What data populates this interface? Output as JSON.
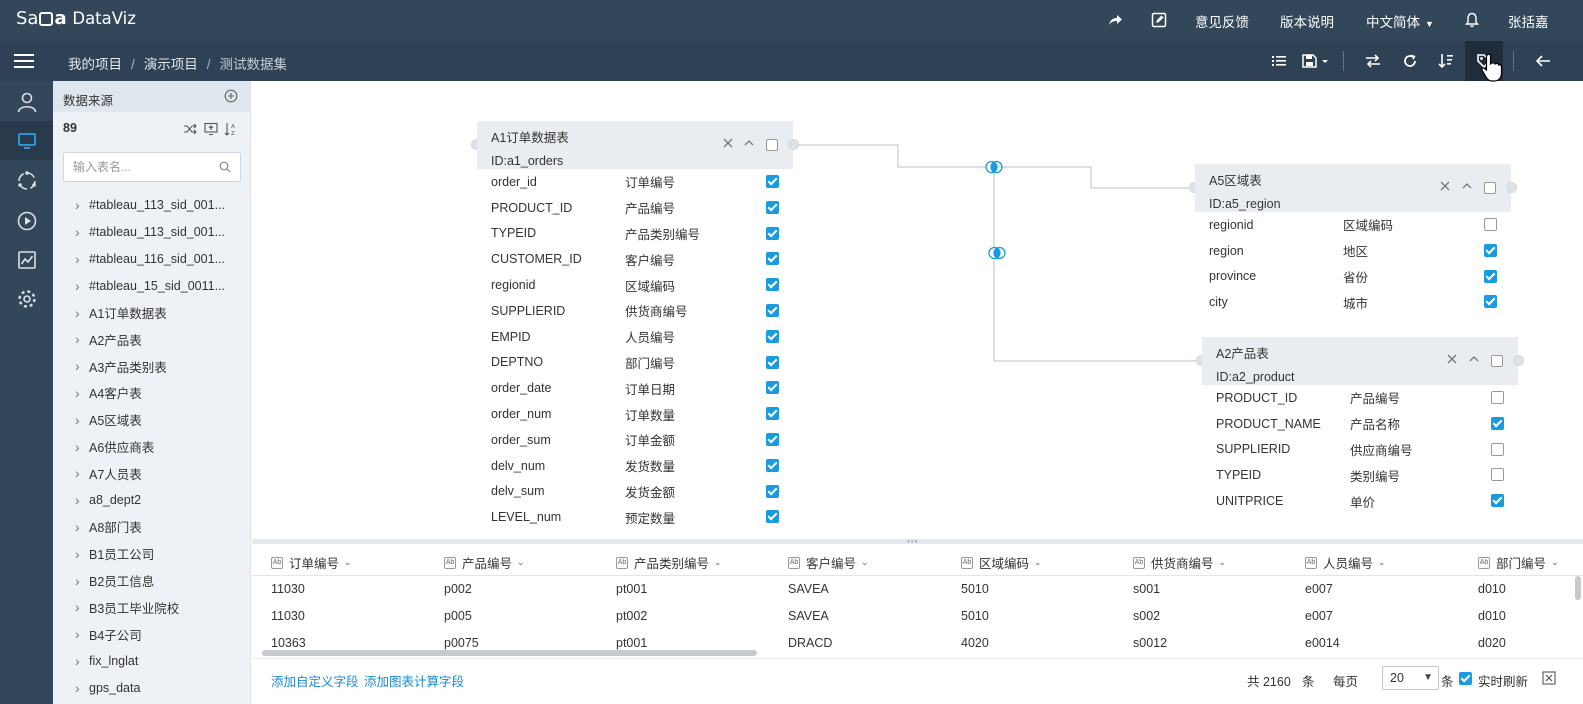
{
  "header": {
    "logo_text": "Sa",
    "logo_rest": "DataViz",
    "feedback": "意见反馈",
    "release_notes": "版本说明",
    "language": "中文简体",
    "user": "张括嘉"
  },
  "breadcrumb": [
    "我的项目",
    "演示项目",
    "测试数据集"
  ],
  "sidebar": {
    "title": "数据来源",
    "count": "89",
    "search_placeholder": "输入表名...",
    "items": [
      "#tableau_113_sid_001...",
      "#tableau_113_sid_001...",
      "#tableau_116_sid_001...",
      "#tableau_15_sid_0011...",
      "A1订单数据表",
      "A2产品表",
      "A3产品类别表",
      "A4客户表",
      "A5区域表",
      "A6供应商表",
      "A7人员表",
      "a8_dept2",
      "A8部门表",
      "B1员工公司",
      "B2员工信息",
      "B3员工毕业院校",
      "B4子公司",
      "fix_lnglat",
      "gps_data"
    ]
  },
  "tables": {
    "orders": {
      "title": "A1订单数据表",
      "id": "ID:a1_orders",
      "fields": [
        {
          "name": "order_id",
          "label": "订单编号",
          "checked": true
        },
        {
          "name": "PRODUCT_ID",
          "label": "产品编号",
          "checked": true
        },
        {
          "name": "TYPEID",
          "label": "产品类别编号",
          "checked": true
        },
        {
          "name": "CUSTOMER_ID",
          "label": "客户编号",
          "checked": true
        },
        {
          "name": "regionid",
          "label": "区域编码",
          "checked": true
        },
        {
          "name": "SUPPLIERID",
          "label": "供货商编号",
          "checked": true
        },
        {
          "name": "EMPID",
          "label": "人员编号",
          "checked": true
        },
        {
          "name": "DEPTNO",
          "label": "部门编号",
          "checked": true
        },
        {
          "name": "order_date",
          "label": "订单日期",
          "checked": true
        },
        {
          "name": "order_num",
          "label": "订单数量",
          "checked": true
        },
        {
          "name": "order_sum",
          "label": "订单金额",
          "checked": true
        },
        {
          "name": "delv_num",
          "label": "发货数量",
          "checked": true
        },
        {
          "name": "delv_sum",
          "label": "发货金额",
          "checked": true
        },
        {
          "name": "LEVEL_num",
          "label": "预定数量",
          "checked": true
        }
      ]
    },
    "region": {
      "title": "A5区域表",
      "id": "ID:a5_region",
      "fields": [
        {
          "name": "regionid",
          "label": "区域编码",
          "checked": false
        },
        {
          "name": "region",
          "label": "地区",
          "checked": true
        },
        {
          "name": "province",
          "label": "省份",
          "checked": true
        },
        {
          "name": "city",
          "label": "城市",
          "checked": true
        }
      ]
    },
    "product": {
      "title": "A2产品表",
      "id": "ID:a2_product",
      "fields": [
        {
          "name": "PRODUCT_ID",
          "label": "产品编号",
          "checked": false
        },
        {
          "name": "PRODUCT_NAME",
          "label": "产品名称",
          "checked": true
        },
        {
          "name": "SUPPLIERID",
          "label": "供应商编号",
          "checked": false
        },
        {
          "name": "TYPEID",
          "label": "类别编号",
          "checked": false
        },
        {
          "name": "UNITPRICE",
          "label": "单价",
          "checked": true
        }
      ]
    }
  },
  "grid": {
    "columns": [
      "订单编号",
      "产品编号",
      "产品类别编号",
      "客户编号",
      "区域编码",
      "供货商编号",
      "人员编号",
      "部门编号"
    ],
    "rows": [
      [
        "11030",
        "p002",
        "pt001",
        "SAVEA",
        "5010",
        "s001",
        "e007",
        "d010"
      ],
      [
        "11030",
        "p005",
        "pt002",
        "SAVEA",
        "5010",
        "s002",
        "e007",
        "d010"
      ],
      [
        "10363",
        "p0075",
        "pt001",
        "DRACD",
        "4020",
        "s0012",
        "e0014",
        "d020"
      ]
    ]
  },
  "footer": {
    "add_custom_field": "添加自定义字段",
    "add_calc_field": "添加图表计算字段",
    "total": "共 2160",
    "total_unit": "条",
    "per_page": "每页",
    "page_size": "20",
    "page_unit": "条",
    "realtime_refresh": "实时刷新",
    "realtime_checked": true
  },
  "colors": {
    "topbar": "#33475b",
    "accent": "#1a9bdf",
    "link": "#1a8ad4"
  }
}
